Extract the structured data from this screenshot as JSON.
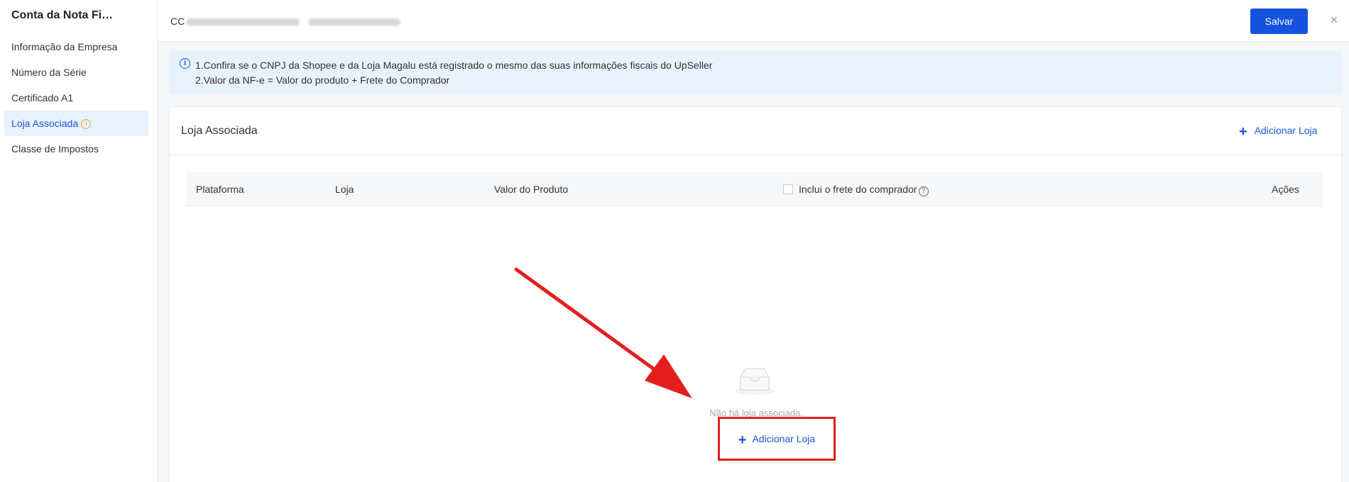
{
  "sidebar": {
    "title": "Conta da Nota Fi…",
    "items": [
      {
        "label": "Informação da Empresa"
      },
      {
        "label": "Número da Série"
      },
      {
        "label": "Certificado A1"
      },
      {
        "label": "Loja Associada"
      },
      {
        "label": "Classe de Impostos"
      }
    ],
    "active_index": 3
  },
  "header": {
    "company_prefix": "CC",
    "save_label": "Salvar",
    "close_symbol": "×"
  },
  "notice": {
    "line1": "1.Confira se o CNPJ da Shopee e da Loja Magalu está registrado o mesmo das suas informações fiscais do UpSeller",
    "line2": "2.Valor da NF-e = Valor do produto + Frete do Comprador"
  },
  "card": {
    "title": "Loja Associada",
    "add_label": "Adicionar Loja",
    "columns": {
      "platform": "Plataforma",
      "store": "Loja",
      "product_value": "Valor do Produto",
      "include_shipping": "Inclui o frete do comprador",
      "actions": "Ações"
    },
    "include_shipping_checked": false,
    "empty_text": "Não há loja associada.",
    "empty_add_label": "Adicionar Loja"
  },
  "colors": {
    "primary": "#1552e0",
    "link": "#1a56db",
    "highlight": "#e41e1e",
    "notice_bg": "#e8f2fd"
  }
}
